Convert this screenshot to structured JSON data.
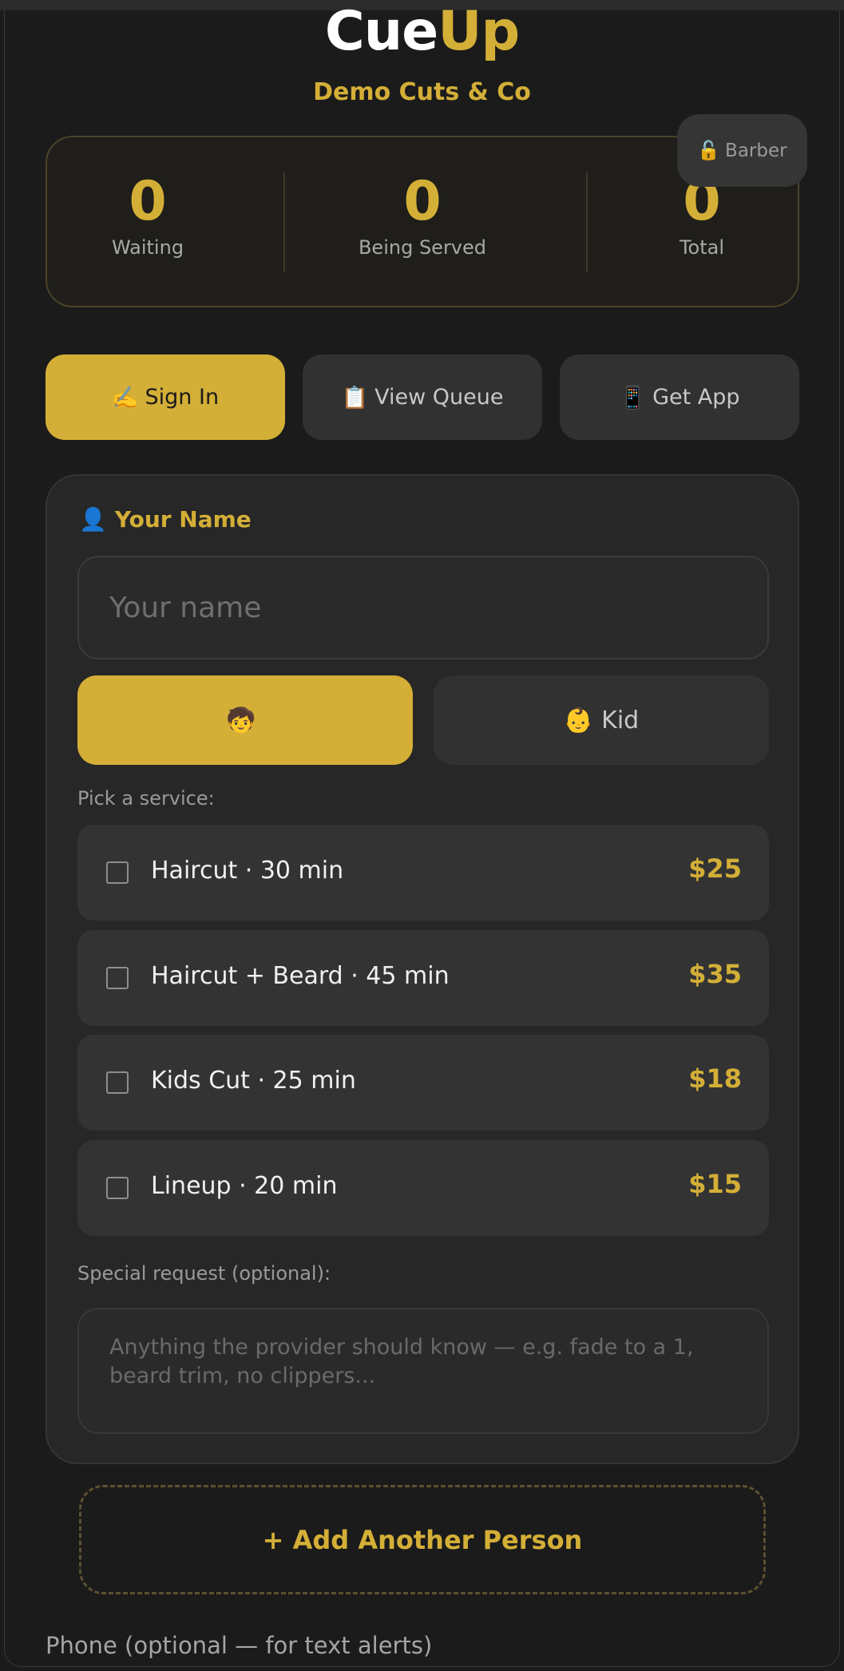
{
  "header": {
    "logo_part1": "Cue",
    "logo_part2": "Up",
    "shop_name": "Demo Cuts & Co",
    "barber_button": {
      "icon": "🔓",
      "label": "Barber"
    }
  },
  "stats": [
    {
      "value": "0",
      "label": "Waiting"
    },
    {
      "value": "0",
      "label": "Being Served"
    },
    {
      "value": "0",
      "label": "Total"
    }
  ],
  "tabs": [
    {
      "icon": "✍️",
      "label": "Sign In",
      "active": true
    },
    {
      "icon": "📋",
      "label": "View Queue",
      "active": false
    },
    {
      "icon": "📱",
      "label": "Get App",
      "active": false
    }
  ],
  "form": {
    "name_label_icon": "👤",
    "name_label": "Your Name",
    "name_value": "",
    "name_placeholder": "Your name",
    "age_options": [
      {
        "icon": "🧒",
        "label": "",
        "active": true
      },
      {
        "icon": "👶",
        "label": "Kid",
        "active": false
      }
    ],
    "service_prompt": "Pick a service:",
    "services": [
      {
        "name": "Haircut · 30 min",
        "price": "$25",
        "checked": false
      },
      {
        "name": "Haircut + Beard · 45 min",
        "price": "$35",
        "checked": false
      },
      {
        "name": "Kids Cut · 25 min",
        "price": "$18",
        "checked": false
      },
      {
        "name": "Lineup · 20 min",
        "price": "$15",
        "checked": false
      }
    ],
    "request_label": "Special request (optional):",
    "request_value": "",
    "request_placeholder": "Anything the provider should know — e.g. fade to a 1, beard trim, no clippers..."
  },
  "add_person_label": "+ Add Another Person",
  "phone_label": "Phone (optional — for text alerts)",
  "colors": {
    "accent": "#d4af37",
    "background": "#1b1b1b",
    "card": "#272727",
    "button_inactive": "#313131"
  }
}
